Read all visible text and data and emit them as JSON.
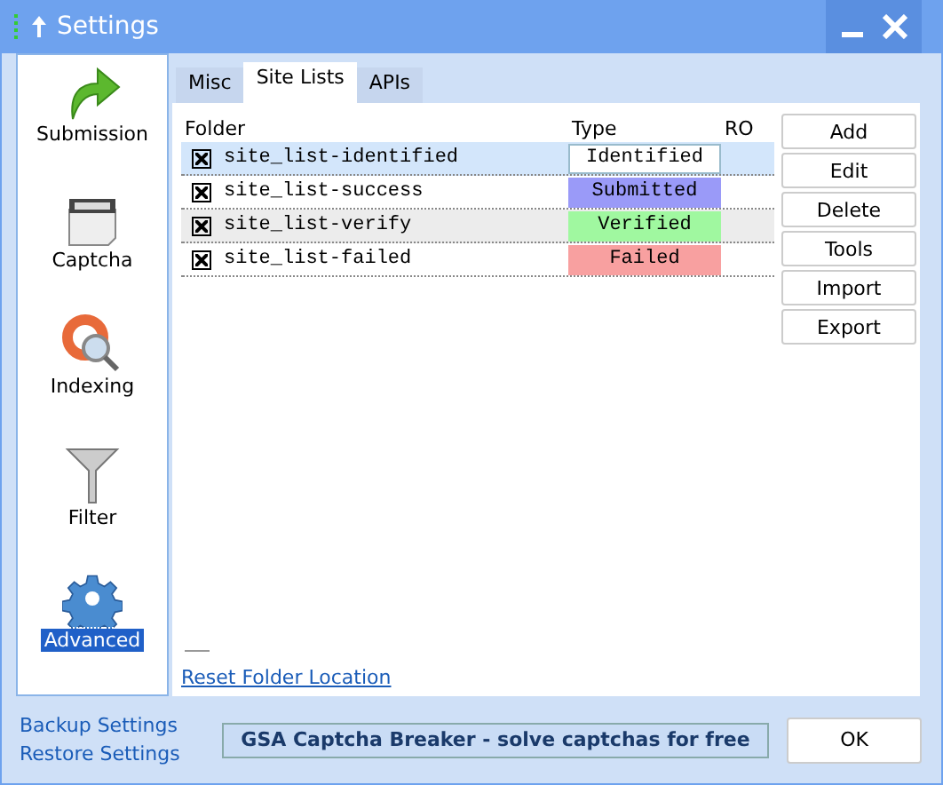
{
  "window": {
    "title": "Settings"
  },
  "sidebar": {
    "items": [
      {
        "label": "Submission",
        "kind": "arrow",
        "selected": false
      },
      {
        "label": "Captcha",
        "kind": "captcha",
        "selected": false
      },
      {
        "label": "Indexing",
        "kind": "lifebuoy",
        "selected": false
      },
      {
        "label": "Filter",
        "kind": "funnel",
        "selected": false
      },
      {
        "label": "Advanced",
        "kind": "gear",
        "selected": true
      }
    ],
    "links": [
      "Backup Settings",
      "Restore Settings"
    ]
  },
  "tabs": [
    {
      "label": "Misc",
      "selected": false
    },
    {
      "label": "Site Lists",
      "selected": true
    },
    {
      "label": "APIs",
      "selected": false
    }
  ],
  "table": {
    "columns": [
      "Folder",
      "Type",
      "RO"
    ],
    "rows": [
      {
        "checked": true,
        "folder": "site_list-identified",
        "type": "Identified",
        "color": "#ffffff",
        "selected": true
      },
      {
        "checked": true,
        "folder": "site_list-success",
        "type": "Submitted",
        "color": "#9a9af8",
        "selected": false
      },
      {
        "checked": true,
        "folder": "site_list-verify",
        "type": "Verified",
        "color": "#a0f8a0",
        "selected": false
      },
      {
        "checked": true,
        "folder": "site_list-failed",
        "type": "Failed",
        "color": "#f8a0a0",
        "selected": false
      }
    ]
  },
  "buttons": [
    "Add",
    "Edit",
    "Delete",
    "Tools",
    "Import",
    "Export"
  ],
  "reset_link": "Reset Folder Location",
  "banner": "GSA Captcha Breaker - solve captchas for free",
  "ok_button": "OK"
}
